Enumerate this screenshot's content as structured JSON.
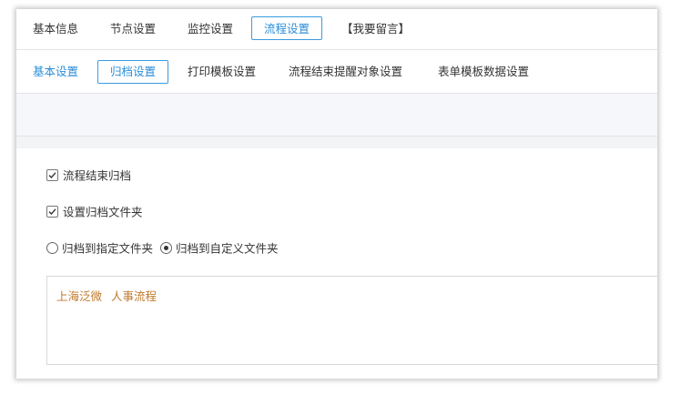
{
  "top_tabs": [
    {
      "label": "基本信息",
      "active": false
    },
    {
      "label": "节点设置",
      "active": false
    },
    {
      "label": "监控设置",
      "active": false
    },
    {
      "label": "流程设置",
      "active": true
    },
    {
      "label": "【我要留言】",
      "active": false
    }
  ],
  "sub_tabs": [
    {
      "label": "基本设置",
      "active": false
    },
    {
      "label": "归档设置",
      "active": true
    },
    {
      "label": "打印模板设置",
      "active": false
    },
    {
      "label": "流程结束提醒对象设置",
      "active": false
    },
    {
      "label": "表单模板数据设置",
      "active": false
    }
  ],
  "options": {
    "archive_on_end": {
      "label": "流程结束归档",
      "checked": true
    },
    "set_archive_folder": {
      "label": "设置归档文件夹",
      "checked": true
    },
    "radio_specified": {
      "label": "归档到指定文件夹",
      "selected": false
    },
    "radio_custom": {
      "label": "归档到自定义文件夹",
      "selected": true
    }
  },
  "folder_path": [
    "上海泛微",
    "人事流程"
  ],
  "colors": {
    "accent": "#2b8ed8",
    "path_text": "#c07a2c"
  }
}
